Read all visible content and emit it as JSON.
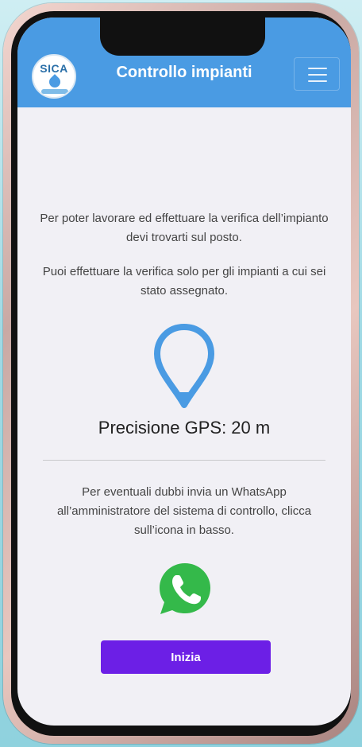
{
  "header": {
    "logo_text": "SICA",
    "title": "Controllo impianti",
    "menu_icon": "hamburger-menu-icon"
  },
  "main": {
    "intro_text": "Per poter lavorare ed effettuare la verifica dell’impianto devi trovarti sul posto.",
    "assign_text": "Puoi effettuare la verifica solo per gli impianti a cui sei stato assegnato.",
    "gps_label": "Precisione GPS: 20 m",
    "help_text": "Per eventuali dubbi invia un WhatsApp all’amministratore del sistema di controllo, clicca sull’icona in basso.",
    "start_label": "Inizia"
  },
  "colors": {
    "header_bg": "#4a9be3",
    "pin": "#4a9be3",
    "whatsapp": "#34b94a",
    "button": "#6c1fe6",
    "screen_bg": "#f1f0f5"
  }
}
